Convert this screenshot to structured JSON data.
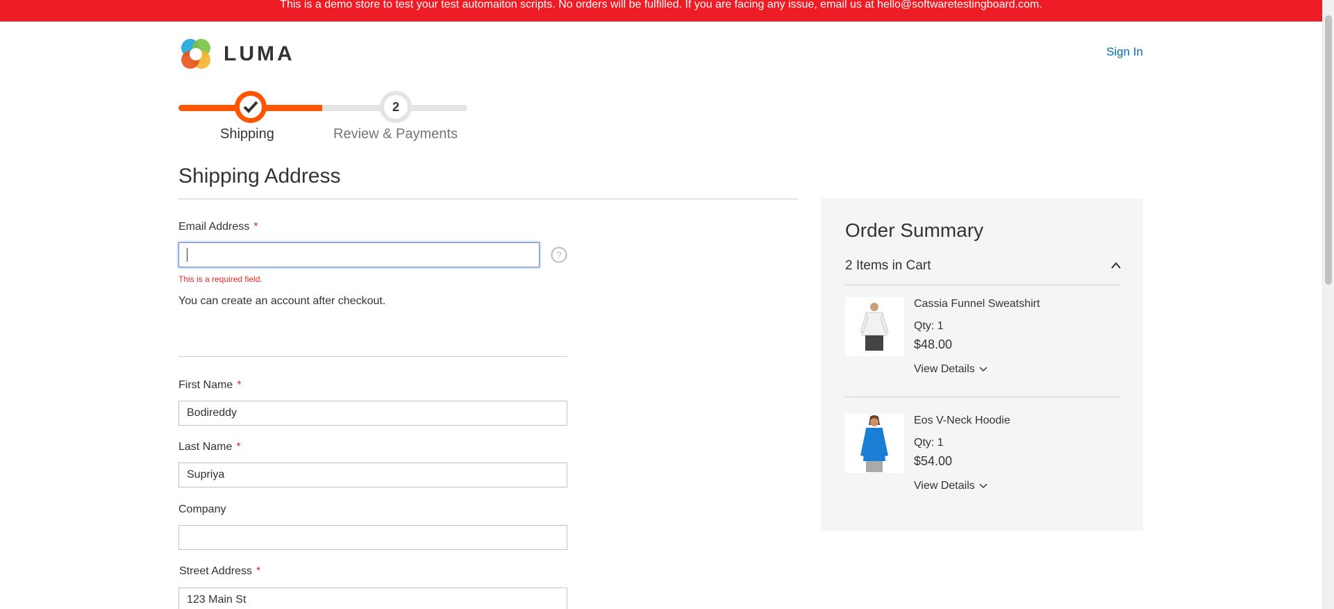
{
  "banner": {
    "text": "This is a demo store to test your test automaiton scripts. No orders will be fulfilled. If you are facing any issue, email us at hello@softwaretestingboard.com."
  },
  "header": {
    "logo_text": "LUMA",
    "sign_in": "Sign In"
  },
  "progress": {
    "steps": [
      {
        "label": "Shipping",
        "status": "complete"
      },
      {
        "label": "Review & Payments",
        "number": "2",
        "status": "pending"
      }
    ],
    "accent_color": "#ff5501"
  },
  "shipping": {
    "title": "Shipping Address",
    "email": {
      "label": "Email Address",
      "value": "",
      "error": "This is a required field.",
      "note": "You can create an account after checkout."
    },
    "first_name": {
      "label": "First Name",
      "value": "Bodireddy"
    },
    "last_name": {
      "label": "Last Name",
      "value": "Supriya"
    },
    "company": {
      "label": "Company",
      "value": ""
    },
    "street": {
      "label": "Street Address",
      "value": "123 Main St"
    },
    "required_mark": "*"
  },
  "summary": {
    "title": "Order Summary",
    "cart_count": "2 Items in Cart",
    "items": [
      {
        "name": "Cassia Funnel Sweatshirt",
        "qty": "Qty: 1",
        "price": "$48.00",
        "details": "View Details"
      },
      {
        "name": "Eos V-Neck Hoodie",
        "qty": "Qty: 1",
        "price": "$54.00",
        "details": "View Details"
      }
    ]
  },
  "colors": {
    "banner": "#ee1c25",
    "link": "#006bb4",
    "error": "#e02b27"
  }
}
